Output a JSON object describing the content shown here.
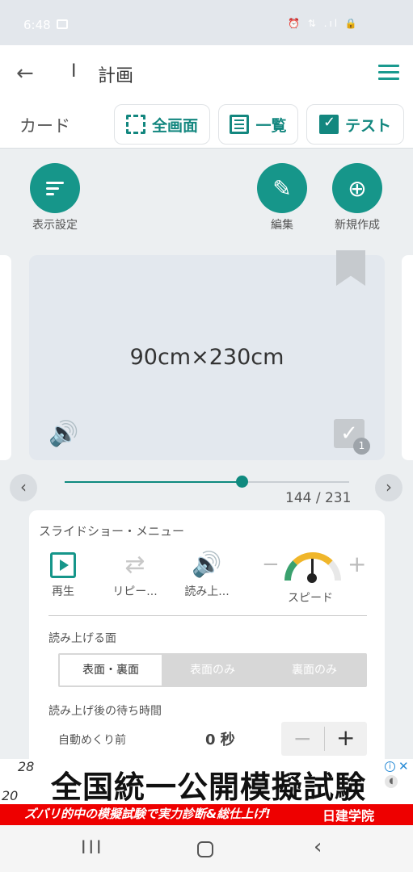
{
  "status_bar": {
    "time": "6:48",
    "right_icons": "⏰ ⇅ .ıl 🔒"
  },
  "app_bar": {
    "back_glyph": "←",
    "breadcrumb": "I",
    "title": "計画"
  },
  "mode_bar": {
    "label": "カード",
    "buttons": [
      {
        "label": "全画面",
        "icon": "fullscreen-icon"
      },
      {
        "label": "一覧",
        "icon": "list-icon"
      },
      {
        "label": "テスト",
        "icon": "test-check-icon"
      }
    ]
  },
  "actions": {
    "display_settings": "表示設定",
    "edit": "編集",
    "new": "新規作成"
  },
  "card": {
    "text": "90cm×230cm",
    "speaker_glyph": "🔊",
    "check_glyph": "✓",
    "check_count": "1"
  },
  "navigator": {
    "prev_glyph": "‹",
    "next_glyph": "›",
    "current": 144,
    "total": 231,
    "counter_text": "144 / 231"
  },
  "slideshow": {
    "title": "スライドショー・メニュー",
    "controls": [
      {
        "label": "再生",
        "icon": "play-icon"
      },
      {
        "label": "リピー...",
        "icon": "repeat-off-icon",
        "glyph": "⇄"
      },
      {
        "label": "読み上...",
        "icon": "speaker-icon",
        "glyph": "🔊"
      }
    ],
    "speed": {
      "label": "スピード",
      "minus": "−",
      "plus": "+"
    },
    "read_side_label": "読み上げる面",
    "read_side_options": [
      "表面・裏面",
      "表面のみ",
      "裏面のみ"
    ],
    "read_side_selected": "表面・裏面",
    "wait_label": "読み上げ後の待ち時間",
    "auto_flip_label": "自動めくり前",
    "auto_flip_value": "0 秒",
    "stepper_minus": "−",
    "stepper_plus": "+"
  },
  "ad": {
    "title": "全国統一公開模擬試験",
    "subtitle": "ズバリ的中の模擬試験で実力診断&総仕上げ!",
    "brand": "日建学院",
    "deco_numbers": [
      "28",
      "20"
    ],
    "info_glyph": "i",
    "close_glyph": "✕",
    "mute_glyph": "◖"
  },
  "system_nav": {
    "recent_glyph": "III",
    "back_glyph": "‹"
  },
  "colors": {
    "accent": "#16968a",
    "ad_red": "#e00000"
  }
}
